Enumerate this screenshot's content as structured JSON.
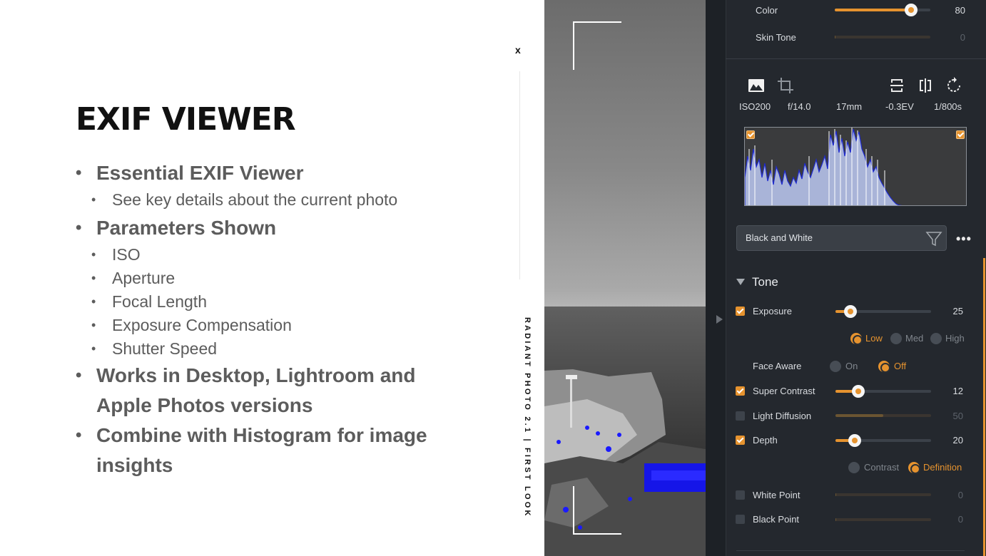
{
  "slide": {
    "title": "EXIF VIEWER",
    "close": "x",
    "vertical_caption": "RADIANT PHOTO 2.1 | FIRST LOOK",
    "sections": [
      {
        "heading": "Essential EXIF Viewer",
        "items": [
          "See key details about the current photo"
        ]
      },
      {
        "heading": "Parameters Shown",
        "items": [
          "ISO",
          "Aperture",
          "Focal Length",
          "Exposure Compensation",
          "Shutter Speed"
        ]
      },
      {
        "heading": "Works in Desktop, Lightroom and Apple Photos versions",
        "items": []
      },
      {
        "heading": "Combine with Histogram for image insights",
        "items": []
      }
    ]
  },
  "panel": {
    "top_sliders": [
      {
        "label": "Color",
        "value": "80",
        "level": 0.8,
        "active": true
      },
      {
        "label": "Skin Tone",
        "value": "0",
        "level": 0.0,
        "active": false
      }
    ],
    "toolbar": {
      "icons": [
        "image-icon",
        "crop-icon",
        "straighten-icon",
        "compare-icon",
        "rotate-icon"
      ]
    },
    "exif": {
      "iso": "ISO200",
      "aperture": "f/14.0",
      "focal_length": "17mm",
      "exposure_comp": "-0.3EV",
      "shutter": "1/800s"
    },
    "histogram": {
      "highlight_clip": true,
      "shadow_clip": true
    },
    "preset": {
      "name": "Black and White",
      "filter_icon": "funnel-icon",
      "more": "•••"
    },
    "tone": {
      "title": "Tone",
      "exposure": {
        "label": "Exposure",
        "checked": true,
        "value": "25",
        "level": 0.25
      },
      "exposure_modes": {
        "options": [
          "Low",
          "Med",
          "High"
        ],
        "selected": "Low"
      },
      "face_aware": {
        "label": "Face Aware",
        "options": [
          "On",
          "Off"
        ],
        "selected": "Off"
      },
      "super_contrast": {
        "label": "Super Contrast",
        "checked": true,
        "value": "12",
        "level": 0.24
      },
      "light_diffusion": {
        "label": "Light Diffusion",
        "checked": false,
        "value": "50",
        "level": 0.5
      },
      "depth": {
        "label": "Depth",
        "checked": true,
        "value": "20",
        "level": 0.2
      },
      "depth_modes": {
        "options": [
          "Contrast",
          "Definition"
        ],
        "selected": "Definition"
      },
      "white_point": {
        "label": "White Point",
        "checked": false,
        "value": "0",
        "level": 0
      },
      "black_point": {
        "label": "Black Point",
        "checked": false,
        "value": "0",
        "level": 0
      }
    },
    "colors": {
      "accent": "#e6932f",
      "panel_bg": "#24282e"
    }
  }
}
